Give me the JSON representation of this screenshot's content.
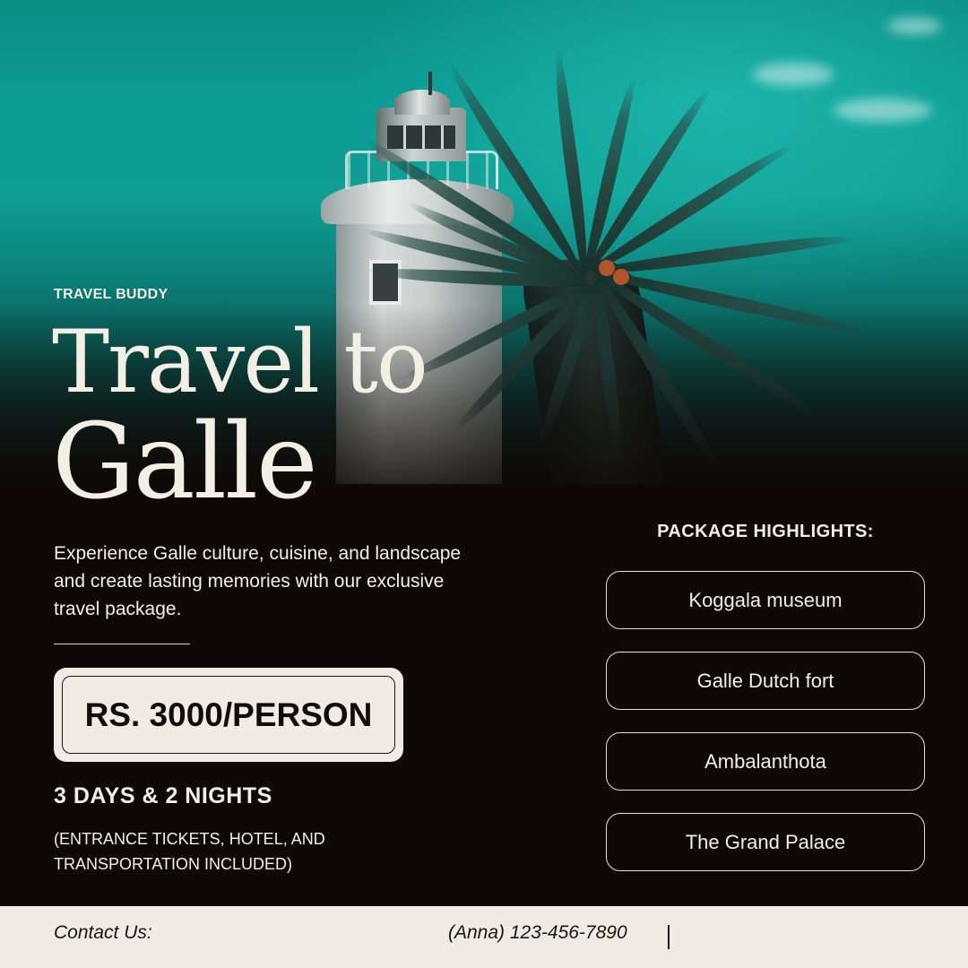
{
  "brand": "TRAVEL BUDDY",
  "title": {
    "line1": "Travel to",
    "line2": "Galle"
  },
  "description": "Experience Galle culture, cuisine, and landscape and create lasting memories with our exclusive travel package.",
  "price": "RS. 3000/PERSON",
  "duration": "3 DAYS & 2 NIGHTS",
  "note": "(ENTRANCE TICKETS, HOTEL, AND TRANSPORTATION INCLUDED)",
  "highlights": {
    "heading": "PACKAGE HIGHLIGHTS:",
    "items": [
      "Koggala museum",
      "Galle Dutch fort",
      "Ambalanthota",
      "The Grand Palace"
    ]
  },
  "footer": {
    "contact_label": "Contact Us:",
    "contact_value": "(Anna) 123-456-7890"
  },
  "colors": {
    "background": "#0e0806",
    "cream": "#f1ece3",
    "sky": "#0c9c93"
  }
}
